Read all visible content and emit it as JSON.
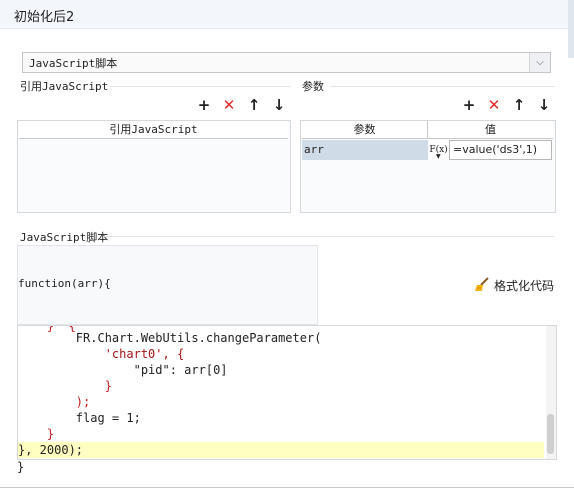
{
  "window": {
    "title": "初始化后2"
  },
  "script_type": {
    "selected": "JavaScript脚本"
  },
  "ref_js": {
    "label": "引用JavaScript",
    "column": "引用JavaScript",
    "toolbar": {
      "add": "+",
      "delete": "✕",
      "up": "↑",
      "down": "↓"
    }
  },
  "params": {
    "label": "参数",
    "columns": [
      "参数",
      "值"
    ],
    "rows": [
      {
        "name": "arr",
        "fx": "F(x)",
        "value": "=value('ds3',1)"
      }
    ],
    "toolbar": {
      "add": "+",
      "delete": "✕",
      "up": "↑",
      "down": "↓"
    }
  },
  "script": {
    "label": "JavaScript脚本",
    "signature": "function(arr){",
    "format_button": "格式化代码",
    "closing": "}",
    "code_lines": [
      "        FR.Chart.WebUtils.changeParameter(",
      "            'chart0', {",
      "                \"pid\": arr[0]",
      "            }",
      "        );",
      "        flag = 1;",
      "    }",
      "}, 2000);"
    ]
  },
  "colors": {
    "highlight_line": "#ffffc2",
    "param_cell": "#cfdbe6",
    "delete_red": "#e12a2a"
  }
}
